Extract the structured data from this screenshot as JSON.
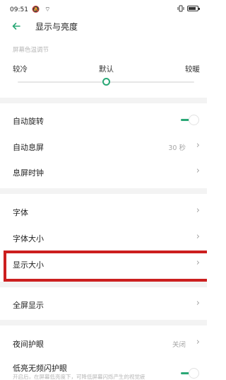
{
  "status_bar": {
    "time": "09:51",
    "left_icons": "🔕 ⌔",
    "right_icons": [
      "vibrate-icon",
      "battery-icon"
    ]
  },
  "header": {
    "title": "显示与亮度",
    "back_icon": "arrow-left-icon"
  },
  "color_temp": {
    "section_label": "屏幕色温调节",
    "left_label": "较冷",
    "middle_label": "默认",
    "right_label": "较暖",
    "slider_value_fraction": 0.5
  },
  "settings": {
    "auto_rotate": {
      "label": "自动旋转",
      "toggle_on": true
    },
    "screen_timeout": {
      "label": "自动息屏",
      "value": "30 秒"
    },
    "lock_clock": {
      "label": "息屏时钟"
    },
    "font": {
      "label": "字体"
    },
    "font_size": {
      "label": "字体大小"
    },
    "display_size": {
      "label": "显示大小"
    },
    "fullscreen": {
      "label": "全屏显示"
    },
    "night_mode": {
      "label": "夜间护眼",
      "value": "关闭"
    },
    "dc_dimming": {
      "label": "低亮无频闪护眼",
      "note": "开启后，在屏幕低亮度下，可降低屏幕闪烁产生的视觉疲",
      "toggle_on": true
    }
  },
  "colors": {
    "accent": "#2aa876",
    "highlight": "#cc1f1f"
  }
}
